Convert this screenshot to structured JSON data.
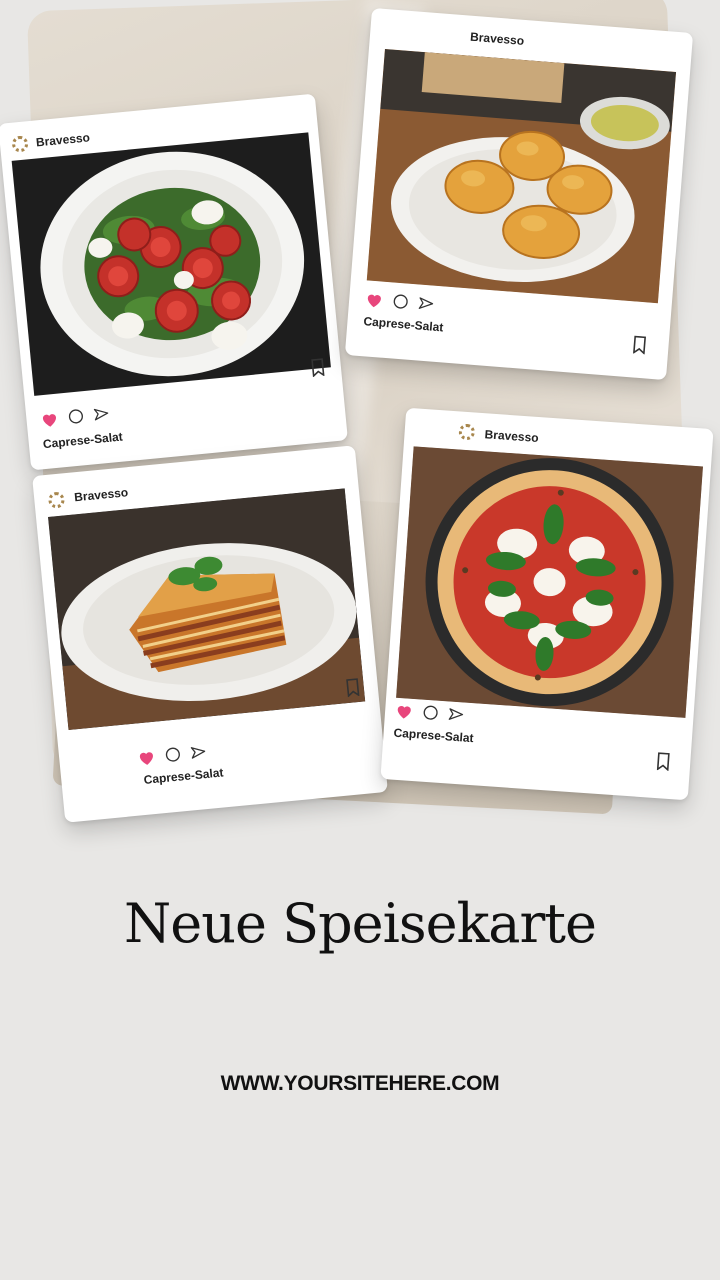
{
  "posts": [
    {
      "brand": "Bravesso",
      "caption": "Caprese-Salat",
      "photo": "caprese-salad"
    },
    {
      "brand": "Bravesso",
      "caption": "Caprese-Salat",
      "photo": "fried-dough-balls"
    },
    {
      "brand": "Bravesso",
      "caption": "Caprese-Salat",
      "photo": "lasagna"
    },
    {
      "brand": "Bravesso",
      "caption": "Caprese-Salat",
      "photo": "margherita-pizza"
    }
  ],
  "icons": [
    "heart-icon",
    "comment-icon",
    "send-icon",
    "bookmark-icon",
    "brand-logo-icon"
  ],
  "colors": {
    "heart": "#e8467c",
    "background": "#e8e7e5",
    "text": "#111111",
    "logo": "#a8874e"
  },
  "headline": "Neue Speisekarte",
  "website": "WWW.YOURSITEHERE.COM"
}
